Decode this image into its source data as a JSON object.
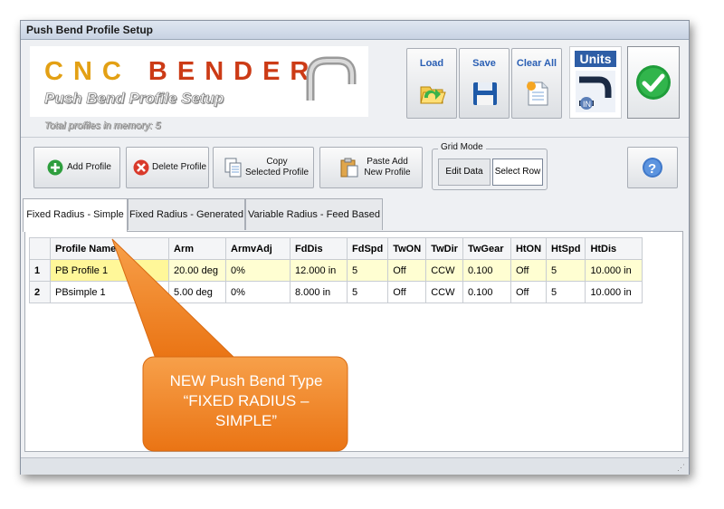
{
  "window": {
    "title": "Push Bend Profile Setup"
  },
  "logo": {
    "brand_part1": "CNC",
    "brand_part2": "BENDER",
    "subtitle": "Push Bend Profile Setup"
  },
  "memory_text": "Total profiles in memory: 5",
  "top_buttons": {
    "load": "Load",
    "save": "Save",
    "clear_all": "Clear All",
    "units": "Units"
  },
  "toolbar": {
    "add_profile": "Add Profile",
    "delete_profile": "Delete Profile",
    "copy_line1": "Copy",
    "copy_line2": "Selected Profile",
    "paste_line1": "Paste Add",
    "paste_line2": "New Profile",
    "grid_mode_label": "Grid Mode",
    "edit_data": "Edit Data",
    "select_row": "Select Row"
  },
  "tabs": [
    "Fixed Radius - Simple",
    "Fixed Radius - Generated",
    "Variable Radius - Feed Based"
  ],
  "grid": {
    "columns": [
      "Profile Name",
      "Arm",
      "ArmvAdj",
      "FdDis",
      "FdSpd",
      "TwON",
      "TwDir",
      "TwGear",
      "HtON",
      "HtSpd",
      "HtDis"
    ],
    "rows": [
      {
        "num": "1",
        "cells": [
          "PB Profile 1",
          "20.00 deg",
          "0%",
          "12.000 in",
          "5",
          "Off",
          "CCW",
          "0.100",
          "Off",
          "5",
          "10.000 in"
        ]
      },
      {
        "num": "2",
        "cells": [
          "PBsimple 1",
          "5.00 deg",
          "0%",
          "8.000 in",
          "5",
          "Off",
          "CCW",
          "0.100",
          "Off",
          "5",
          "10.000 in"
        ]
      }
    ]
  },
  "callout": {
    "line1": "NEW Push Bend Type",
    "line2": "“FIXED RADIUS –",
    "line3": "SIMPLE”"
  },
  "colors": {
    "accent_blue": "#2e5ea6",
    "callout_orange": "#f07f1e",
    "selected_row": "#fffed2",
    "selected_cell": "#fff799"
  }
}
